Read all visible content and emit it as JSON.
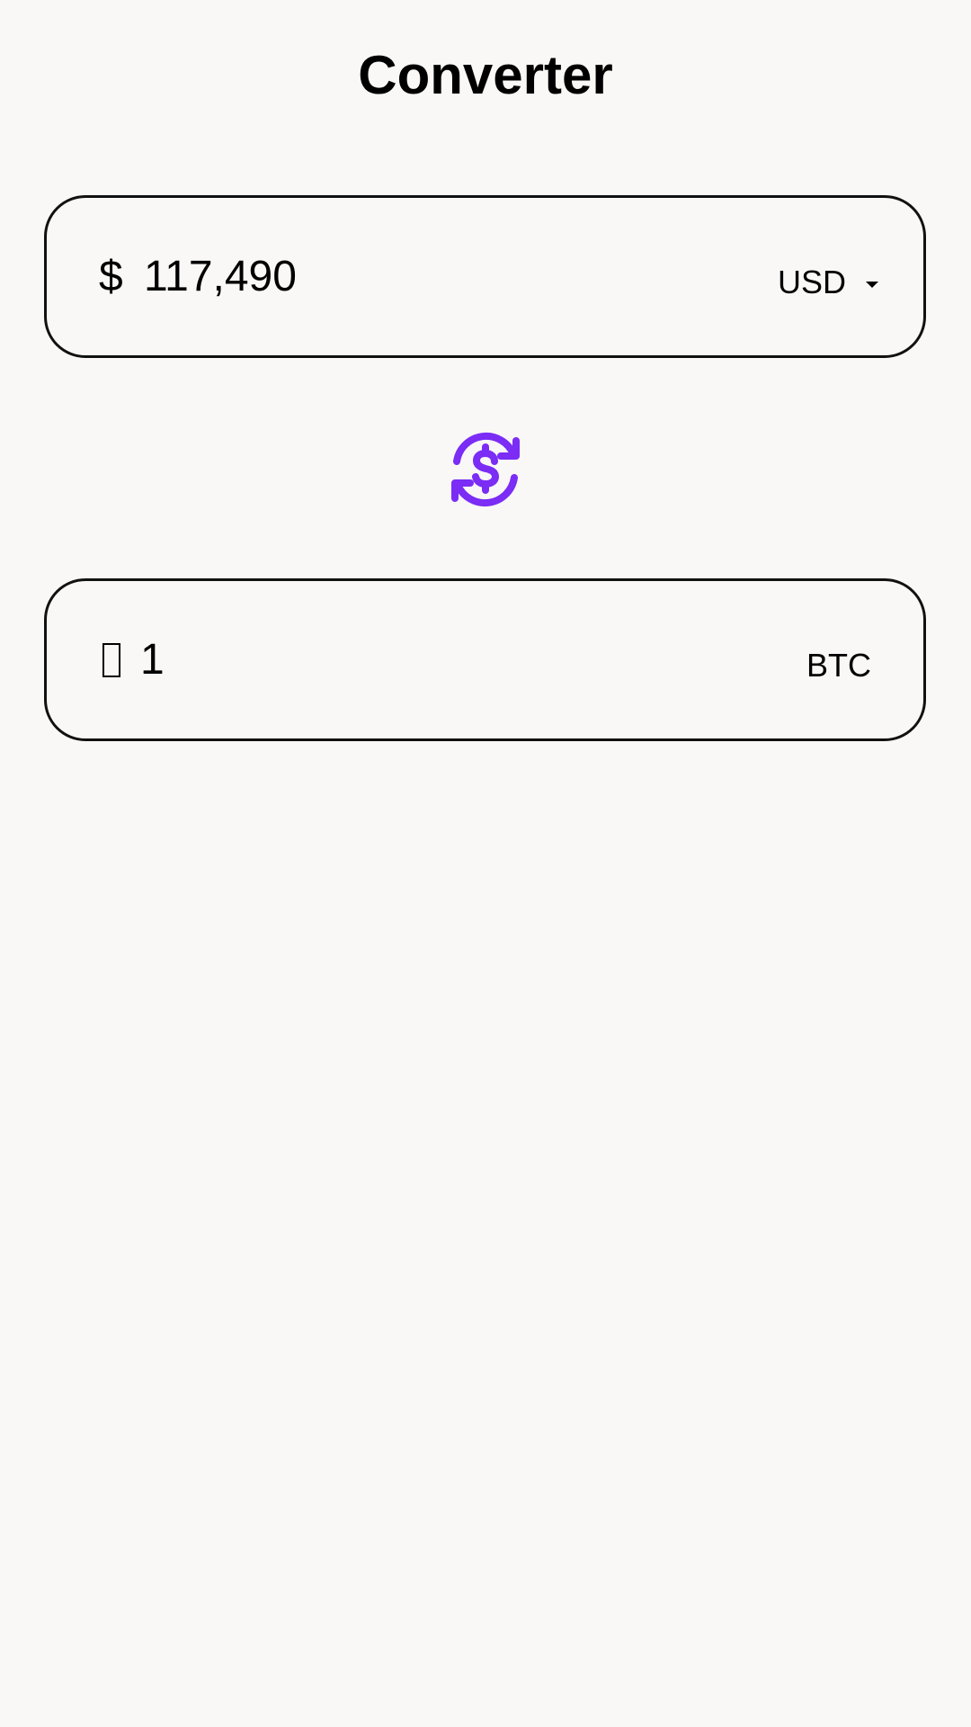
{
  "header": {
    "title": "Converter"
  },
  "from": {
    "symbol": "$",
    "amount": "117,490",
    "currency": "USD"
  },
  "to": {
    "symbol_glyph": "missing-glyph-box",
    "amount": "1",
    "currency": "BTC"
  },
  "swap": {
    "icon": "currency-exchange-icon",
    "color": "#7b2cf5"
  },
  "colors": {
    "background": "#f9f8f6",
    "border": "#111111",
    "accent": "#7b2cf5"
  }
}
